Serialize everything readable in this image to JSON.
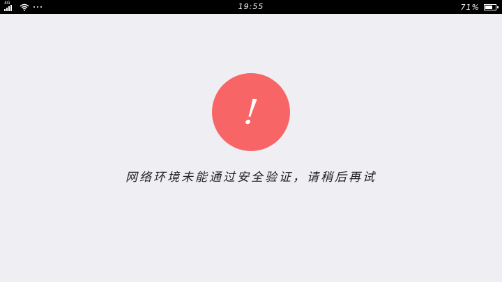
{
  "status_bar": {
    "network_type": "4G",
    "time": "19:55",
    "battery_percent": "71%",
    "battery_level": 0.71,
    "icons": [
      "signal-icon",
      "wifi-icon",
      "more-notifications-icon",
      "battery-icon"
    ]
  },
  "error": {
    "icon_glyph": "!",
    "icon": "exclamation-icon",
    "message": "网络环境未能通过安全验证，请稍后再试"
  },
  "colors": {
    "background": "#efeef3",
    "status_bar": "#000000",
    "error_accent": "#f76566"
  }
}
